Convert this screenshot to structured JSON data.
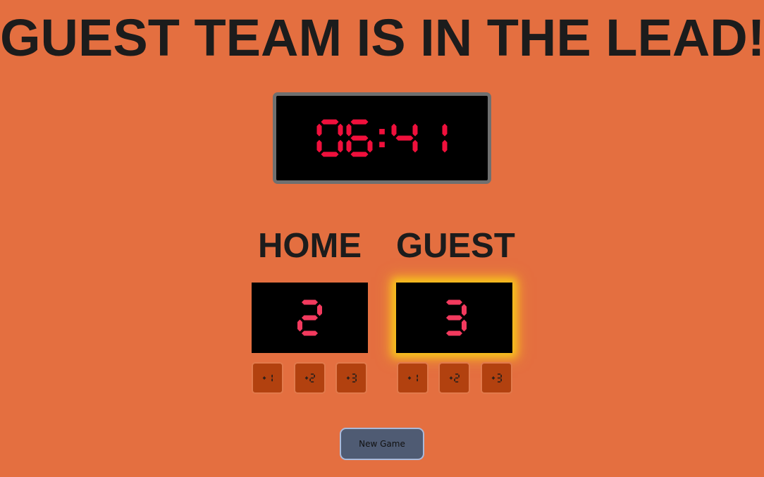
{
  "banner": {
    "text": "GUEST TEAM IS IN THE LEAD!"
  },
  "timer": {
    "display": "06:41",
    "color": "#f0103c"
  },
  "teams": {
    "home": {
      "label": "HOME",
      "score": "2",
      "leading": false,
      "buttons": [
        "+1",
        "+2",
        "+3"
      ]
    },
    "guest": {
      "label": "GUEST",
      "score": "3",
      "leading": true,
      "buttons": [
        "+1",
        "+2",
        "+3"
      ]
    }
  },
  "controls": {
    "new_game_label": "New Game"
  },
  "colors": {
    "background": "#e46f40",
    "score_digit": "#f23a5e",
    "button_glyph": "#1c1c1c",
    "leader_glow": "#f6c21b",
    "button_fill": "#b2410f",
    "new_game_fill": "#4f5b73"
  }
}
